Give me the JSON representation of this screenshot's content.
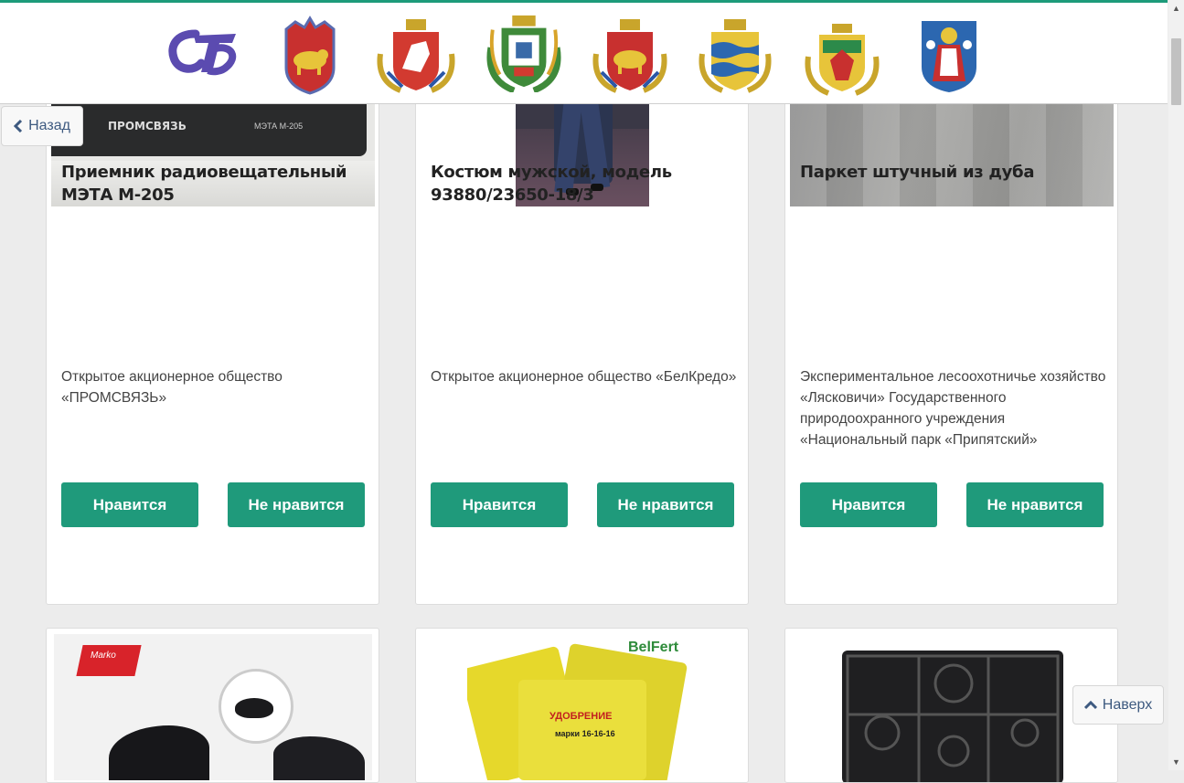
{
  "nav": {
    "back_label": "Назад",
    "top_label": "Наверх"
  },
  "header": {
    "logos": [
      {
        "name": "stb-logo"
      },
      {
        "name": "grodno-coat-of-arms"
      },
      {
        "name": "vitebsk-region-coat-of-arms"
      },
      {
        "name": "gomel-region-coat-of-arms"
      },
      {
        "name": "brest-region-coat-of-arms"
      },
      {
        "name": "minsk-region-coat-of-arms"
      },
      {
        "name": "mogilev-region-coat-of-arms"
      },
      {
        "name": "minsk-city-coat-of-arms"
      }
    ],
    "stb_text": "СТБ"
  },
  "cards": [
    {
      "title": "Приемник радиовещательный МЭТА М-205",
      "company": "Открытое акционерное общество «ПРОМСВЯЗЬ»",
      "like": "Нравится",
      "dislike": "Не нравится",
      "image_text_brand": "ПРОМСВЯЗЬ",
      "image_text_model": "МЭТА М-205"
    },
    {
      "title": "Костюм мужской, модель 93880/23650-18/3",
      "company": "Открытое акционерное общество «БелКредо»",
      "like": "Нравится",
      "dislike": "Не нравится"
    },
    {
      "title": "Паркет штучный из дуба",
      "company": "Экспериментальное лесоохотничье хозяйство «Лясковичи» Государственного природоохранного учреждения «Национальный парк «Припятский»",
      "like": "Нравится",
      "dislike": "Не нравится"
    }
  ],
  "bottom_cards": [
    {
      "image": "women-shoes",
      "brand": "Marko"
    },
    {
      "image": "fertilizer-bags",
      "brand": "BelFert",
      "label": "УДОБРЕНИЕ",
      "mark": "марки 16-16-16"
    },
    {
      "image": "gas-hob"
    }
  ],
  "colors": {
    "accent": "#1f9a7b",
    "link": "#3e5a80",
    "background": "#ececec"
  }
}
